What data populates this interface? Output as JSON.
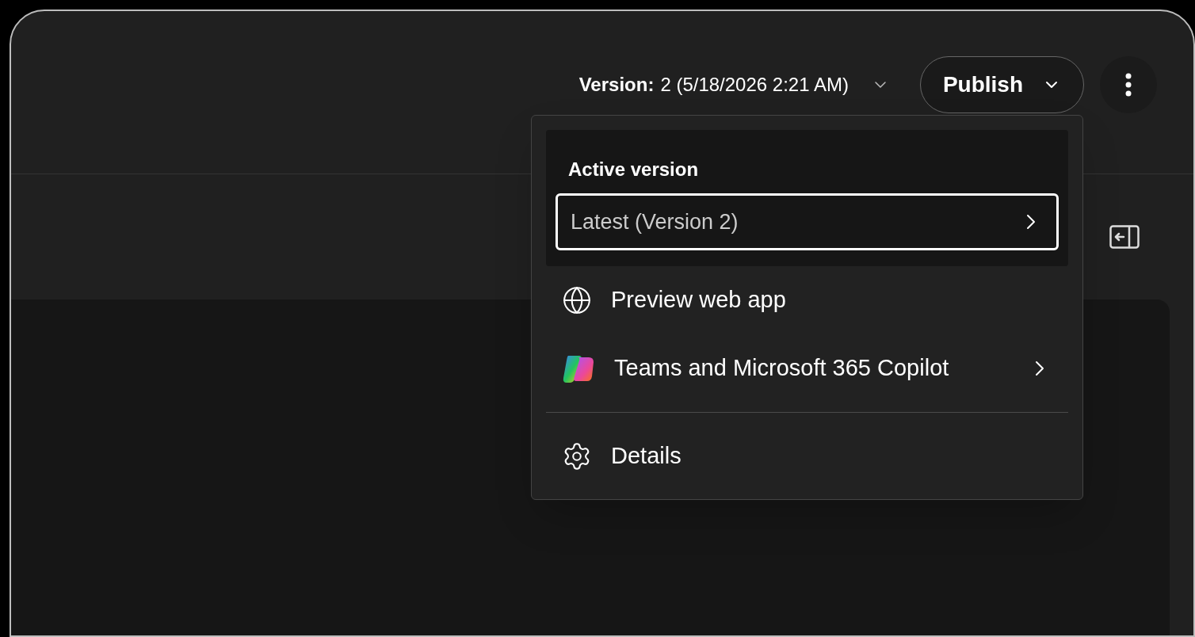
{
  "header": {
    "version_label": "Version:",
    "version_value": "2 (5/18/2026 2:21 AM)",
    "publish_button": "Publish"
  },
  "menu": {
    "section_title": "Active version",
    "version_select": "Latest (Version 2)",
    "items": [
      {
        "kind": "globe",
        "label": "Preview web app",
        "submenu": false,
        "divider_before": false
      },
      {
        "kind": "copilot",
        "label": "Teams and Microsoft 365 Copilot",
        "submenu": true,
        "divider_before": false
      },
      {
        "kind": "gear",
        "label": "Details",
        "submenu": false,
        "divider_before": true
      }
    ]
  }
}
